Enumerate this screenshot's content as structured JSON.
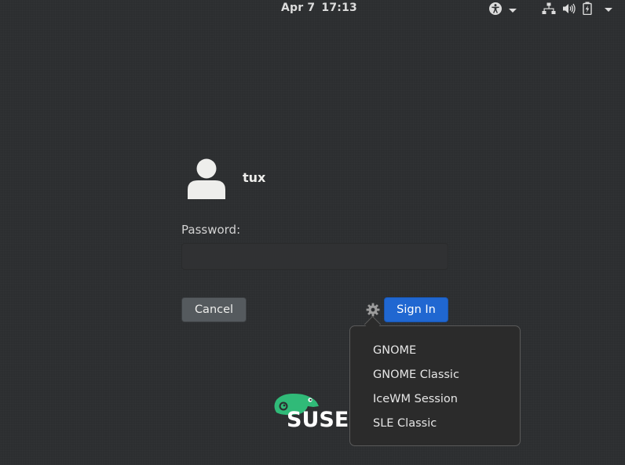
{
  "topbar": {
    "date": "Apr 7",
    "time": "17:13",
    "icons": [
      "accessibility-icon",
      "network-icon",
      "volume-icon",
      "battery-icon",
      "system-menu-chevron-icon"
    ]
  },
  "login": {
    "username": "tux",
    "password_label": "Password:",
    "password_value": "",
    "cancel_label": "Cancel",
    "signin_label": "Sign In"
  },
  "session_menu": {
    "items": [
      "GNOME",
      "GNOME Classic",
      "IceWM Session",
      "SLE Classic"
    ]
  },
  "logo": {
    "text": "SUSE"
  },
  "colors": {
    "background": "#2c2e30",
    "accent": "#2067d1",
    "suse_green": "#30ba78"
  }
}
